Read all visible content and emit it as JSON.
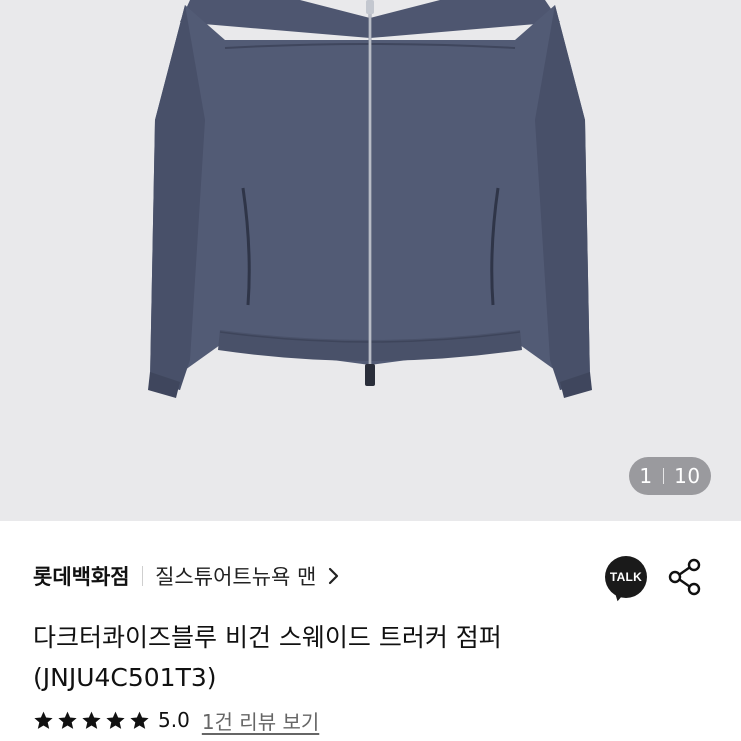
{
  "gallery": {
    "image_alt_icon": "jacket-photo",
    "counter_current": "1",
    "counter_total": "10"
  },
  "brand": {
    "store": "롯데백화점",
    "brand_name": "질스튜어트뉴욕 맨",
    "chevron_icon": "chevron-right-icon"
  },
  "actions": {
    "talk_label": "TALK",
    "share_icon": "share-icon"
  },
  "product": {
    "title_line1": "다크터콰이즈블루 비건 스웨이드 트러커 점퍼",
    "title_line2": "(JNJU4C501T3)"
  },
  "rating": {
    "stars": 5,
    "score": "5.0",
    "review_link": "1건 리뷰 보기"
  },
  "colors": {
    "jacket": "#525b75",
    "background": "#e9e9eb"
  }
}
